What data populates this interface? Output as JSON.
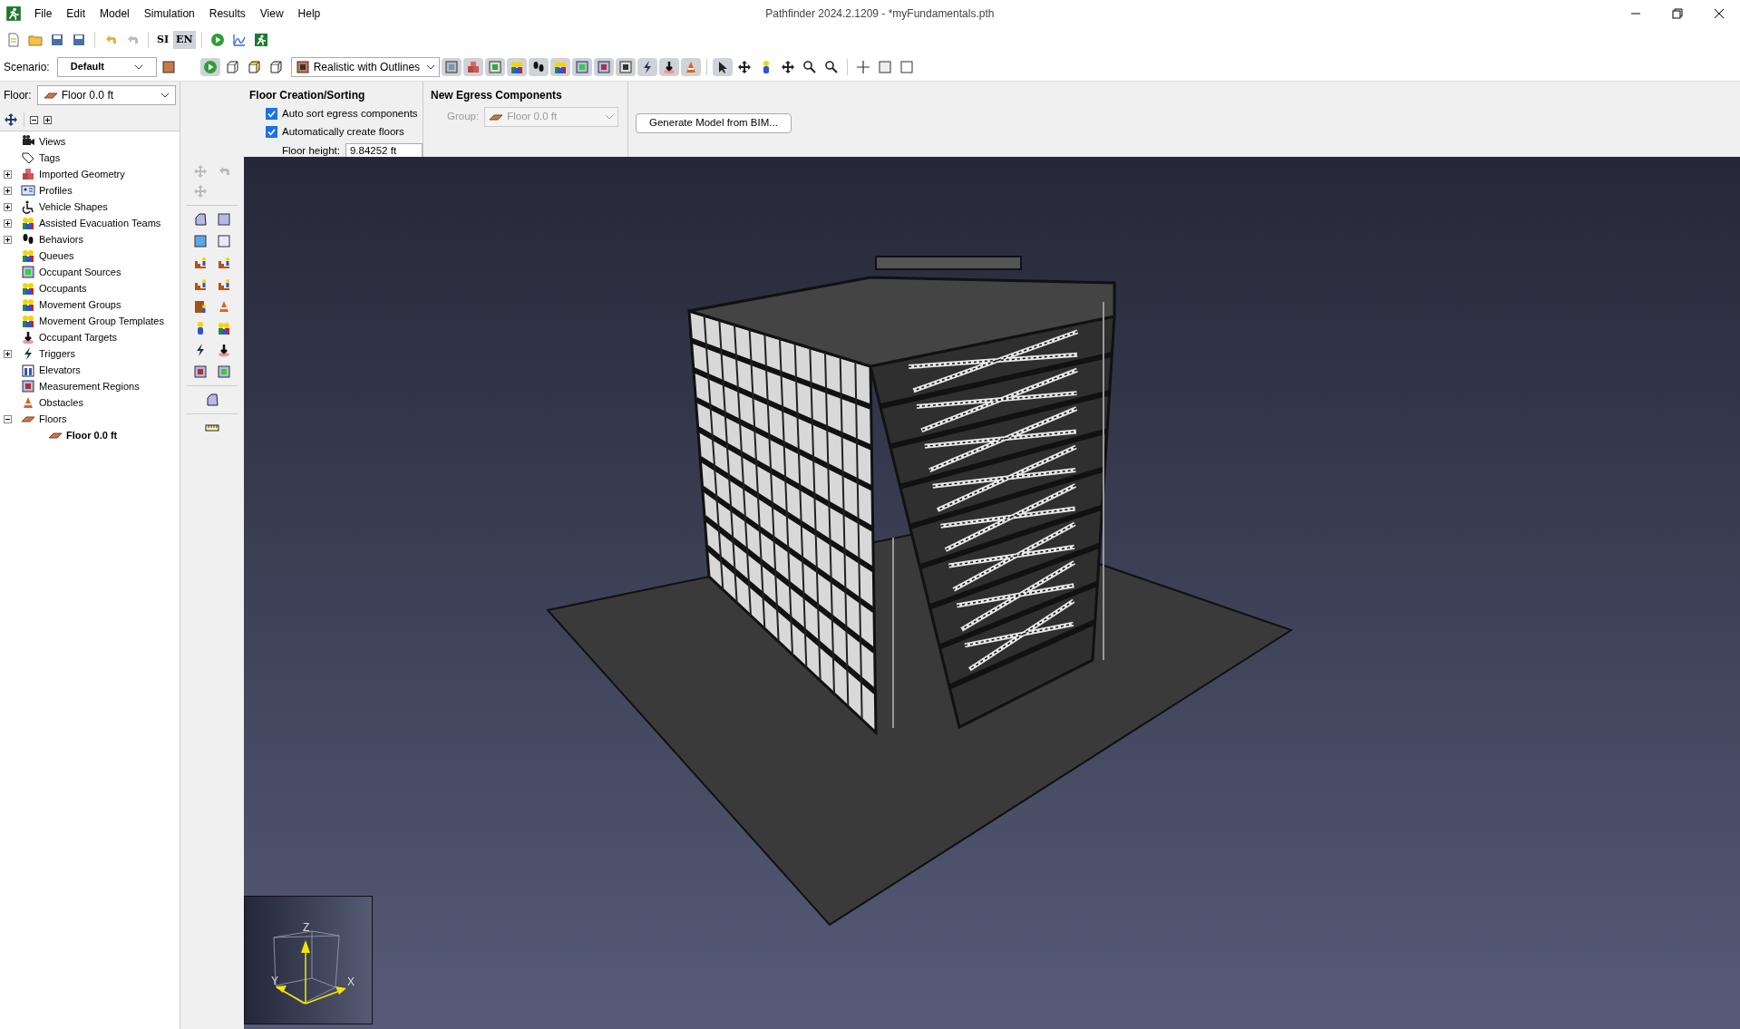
{
  "window": {
    "title": "Pathfinder 2024.2.1209 - *myFundamentals.pth"
  },
  "menu": [
    "File",
    "Edit",
    "Model",
    "Simulation",
    "Results",
    "View",
    "Help"
  ],
  "units": [
    {
      "label": "SI",
      "selected": false
    },
    {
      "label": "EN",
      "selected": true
    }
  ],
  "scenario": {
    "label": "Scenario:",
    "value": "Default"
  },
  "view_mode": {
    "value": "Realistic with Outlines"
  },
  "floor_selector": {
    "label": "Floor:",
    "value": "Floor 0.0 ft"
  },
  "tree": [
    {
      "label": "Views"
    },
    {
      "label": "Tags"
    },
    {
      "label": "Imported Geometry",
      "expanded": false
    },
    {
      "label": "Profiles",
      "expanded": false
    },
    {
      "label": "Vehicle Shapes",
      "expanded": false
    },
    {
      "label": "Assisted Evacuation Teams",
      "expanded": false
    },
    {
      "label": "Behaviors",
      "expanded": false
    },
    {
      "label": "Queues"
    },
    {
      "label": "Occupant Sources"
    },
    {
      "label": "Occupants"
    },
    {
      "label": "Movement Groups"
    },
    {
      "label": "Movement Group Templates"
    },
    {
      "label": "Occupant Targets"
    },
    {
      "label": "Triggers",
      "expanded": false
    },
    {
      "label": "Elevators"
    },
    {
      "label": "Measurement Regions"
    },
    {
      "label": "Obstacles"
    },
    {
      "label": "Floors",
      "expanded": true,
      "children": [
        {
          "label": "Floor 0.0 ft",
          "active": true
        }
      ]
    }
  ],
  "floor_creation": {
    "title": "Floor Creation/Sorting",
    "options": [
      {
        "label": "Auto sort egress components",
        "checked": true
      },
      {
        "label": "Automatically create floors",
        "checked": true
      }
    ],
    "floor_height": {
      "label": "Floor height:",
      "value": "9.84252 ft"
    }
  },
  "new_egress": {
    "title": "New Egress Components",
    "group": {
      "label": "Group:",
      "value": "Floor 0.0 ft",
      "disabled": true
    }
  },
  "bim_button": "Generate Model from BIM...",
  "axes": {
    "z": "Z",
    "y": "Y",
    "x": "X"
  }
}
